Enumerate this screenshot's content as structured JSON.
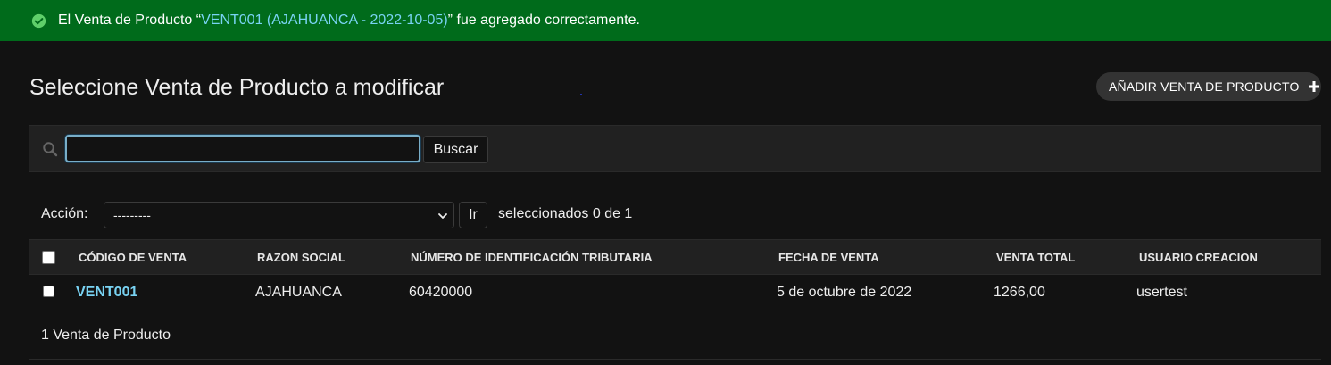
{
  "message": {
    "prefix": "El Venta de Producto “",
    "link_text": "VENT001 (AJAHUANCA - 2022-10-05)",
    "suffix": "” fue agregado correctamente.",
    "icon": "check-circle-icon",
    "background": "#006b1b"
  },
  "page": {
    "title": "Seleccione Venta de Producto a modificar",
    "add_button": "AÑADIR VENTA DE PRODUCTO",
    "add_icon": "plus-icon"
  },
  "search": {
    "value": "",
    "button": "Buscar",
    "icon": "search-icon"
  },
  "actions": {
    "label": "Acción:",
    "selected_option": "---------",
    "go_button": "Ir",
    "selected_count": "seleccionados 0 de 1"
  },
  "table": {
    "headers": [
      "CÓDIGO DE VENTA",
      "RAZON SOCIAL",
      "NÚMERO DE IDENTIFICACIÓN TRIBUTARIA",
      "FECHA DE VENTA",
      "VENTA TOTAL",
      "USUARIO CREACION"
    ],
    "rows": [
      [
        "VENT001",
        "AJAHUANCA",
        "60420000",
        "5 de octubre de 2022",
        "1266,00",
        "usertest"
      ]
    ]
  },
  "footer": {
    "count_text": "1 Venta de Producto"
  },
  "colors": {
    "link": "#79d3f3",
    "background": "#121212",
    "bar": "#212121"
  }
}
